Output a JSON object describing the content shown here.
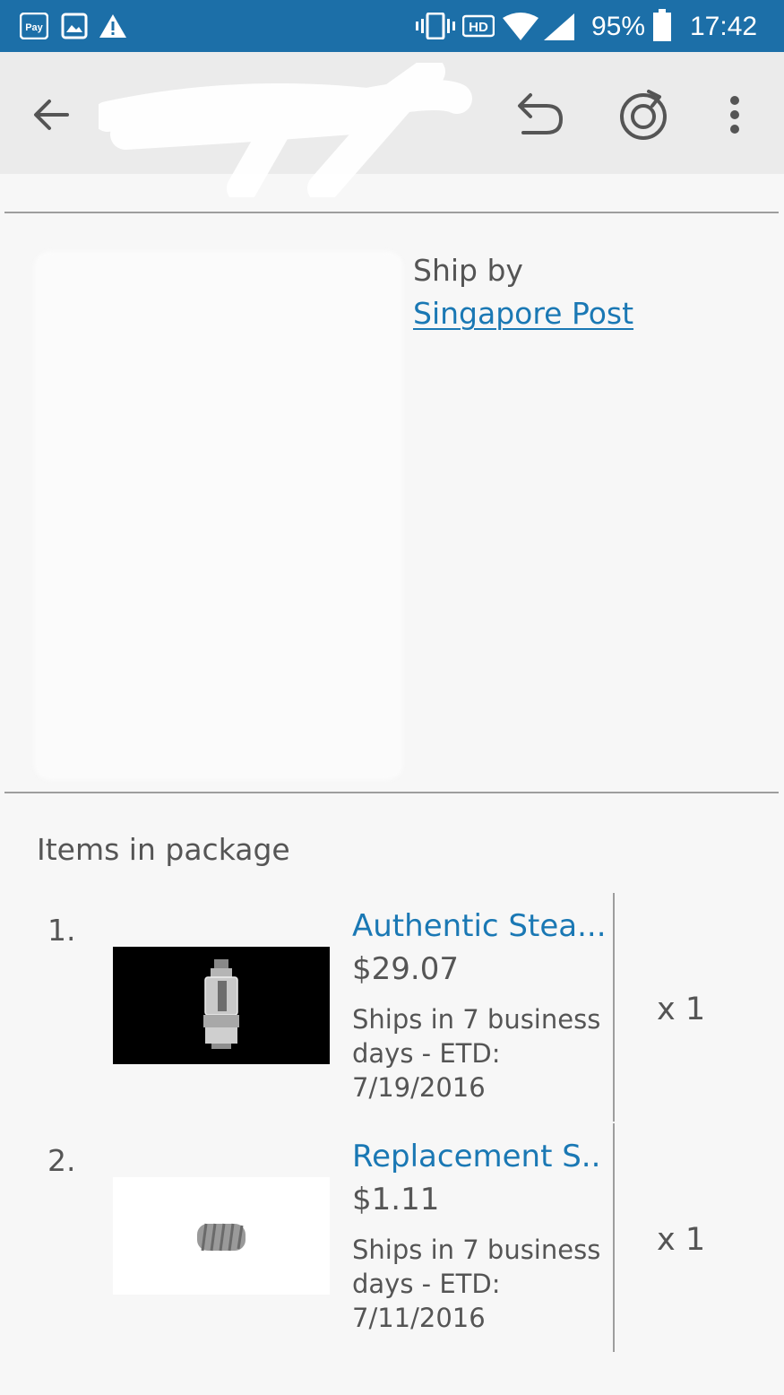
{
  "status_bar": {
    "battery": "95%",
    "time": "17:42",
    "icons": [
      "pay-icon",
      "image-icon",
      "warning-icon",
      "vibrate-icon",
      "hd-icon",
      "wifi-icon",
      "signal-icon",
      "battery-icon"
    ],
    "pay_label": "Pay",
    "hd_label": "HD"
  },
  "toolbar": {
    "icons": [
      "back-arrow-icon",
      "undo-icon",
      "refresh-icon",
      "more-vert-icon"
    ]
  },
  "shipping": {
    "label": "Ship by",
    "carrier": "Singapore Post"
  },
  "package": {
    "title": "Items in package",
    "items": [
      {
        "number": "1.",
        "name": "Authentic Stea...",
        "price": "$29.07",
        "ship_line1": "Ships in 7 business",
        "ship_line2": "days - ETD:",
        "ship_line3": "7/19/2016",
        "quantity": "x 1"
      },
      {
        "number": "2.",
        "name": "Replacement S...",
        "price": "$1.11",
        "ship_line1": "Ships in 7 business",
        "ship_line2": "days - ETD:",
        "ship_line3": "7/11/2016",
        "quantity": "x 1"
      }
    ]
  },
  "colors": {
    "status_bar": "#1c6fa8",
    "toolbar": "#ebebeb",
    "link": "#1a78b4",
    "text": "#555555",
    "divider": "#9e9e9e"
  }
}
